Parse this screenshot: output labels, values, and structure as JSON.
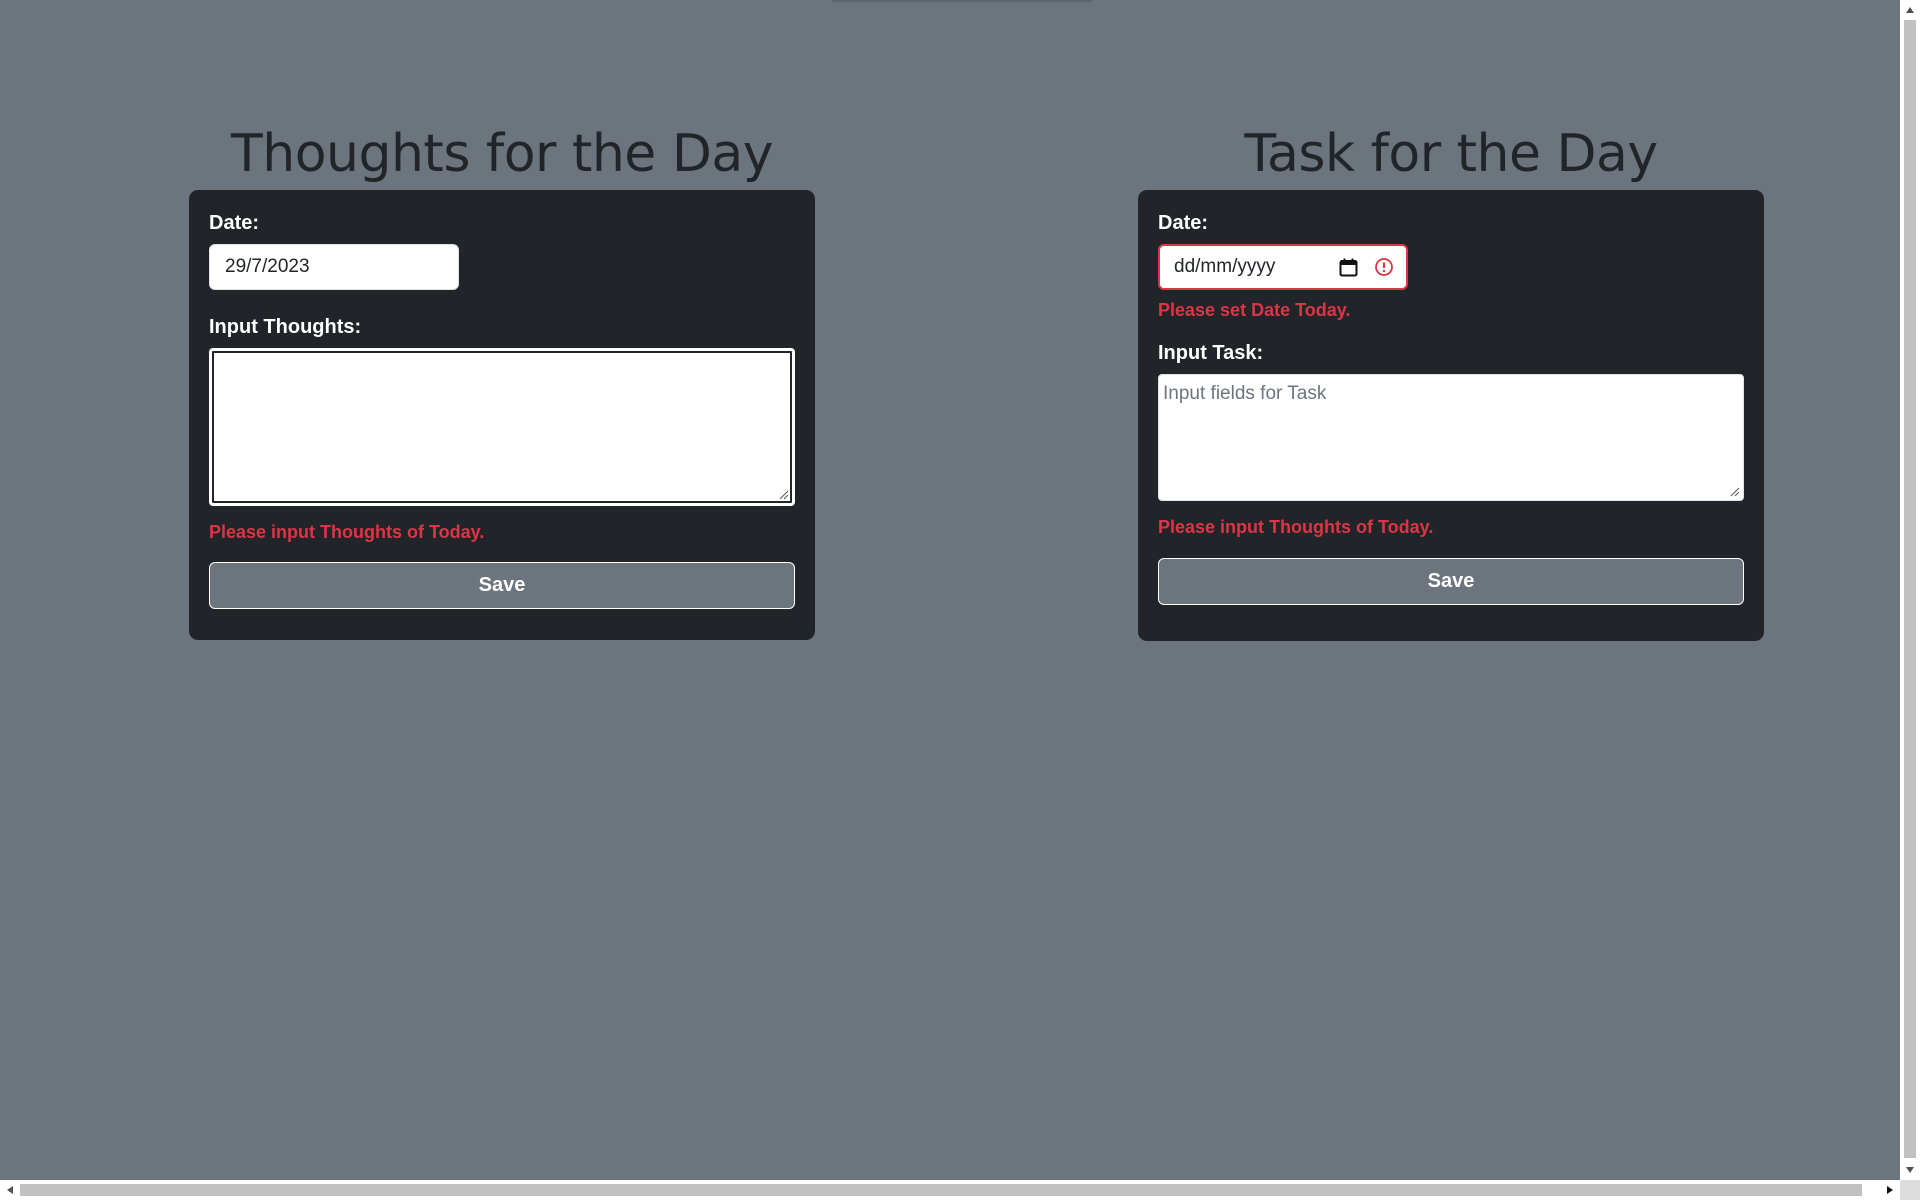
{
  "thoughts": {
    "title": "Thoughts for the Day",
    "date_label": "Date:",
    "date_value": "29/7/2023",
    "input_label": "Input Thoughts:",
    "input_value": "",
    "error": "Please input Thoughts of Today.",
    "save_label": "Save"
  },
  "task": {
    "title": "Task for the Day",
    "date_label": "Date:",
    "date_placeholder": "dd/mm/yyyy",
    "date_error": "Please set Date Today.",
    "input_label": "Input Task:",
    "input_placeholder": "Input fields for Task",
    "error": "Please input Thoughts of Today.",
    "save_label": "Save"
  },
  "colors": {
    "background": "#6c757d",
    "card": "#212529",
    "error": "#dc3545",
    "text_light": "#ffffff"
  },
  "icons": {
    "calendar": "calendar-icon",
    "alert": "alert-circle-icon"
  }
}
